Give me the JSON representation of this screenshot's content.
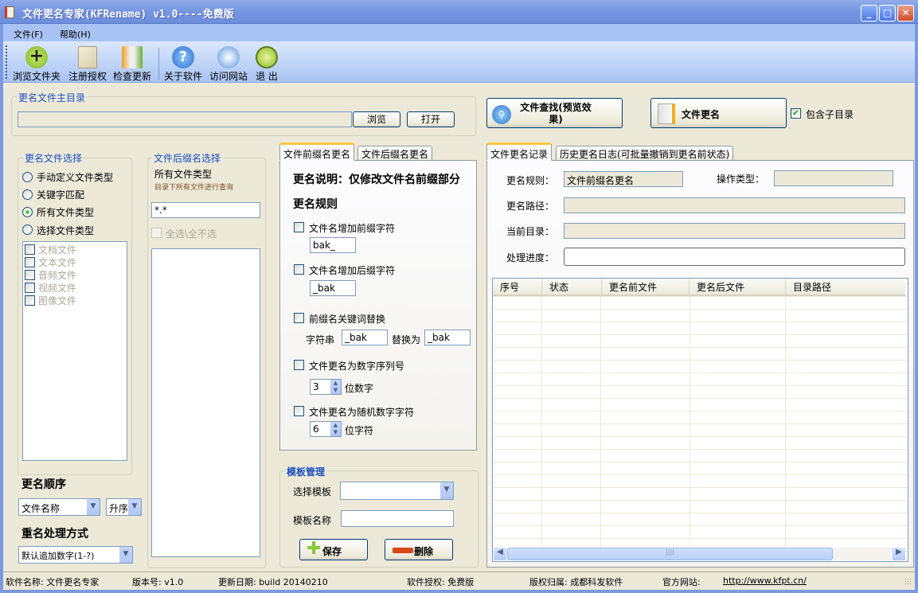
{
  "window": {
    "title": "文件更名专家(KFRename) v1.0----免费版",
    "minimize": "_",
    "maximize": "□",
    "close": "✕"
  },
  "menu": [
    "文件(F)",
    "帮助(H)"
  ],
  "toolbar": [
    {
      "label": "浏览文件夹",
      "icon": "add-folder-icon"
    },
    {
      "label": "注册授权",
      "icon": "key-document-icon"
    },
    {
      "label": "检查更新",
      "icon": "update-icon"
    },
    {
      "label": "关于软件",
      "icon": "help-icon"
    },
    {
      "label": "访问网站",
      "icon": "globe-icon"
    },
    {
      "label": "退 出",
      "icon": "exit-clock-icon"
    }
  ],
  "main_dir": {
    "legend": "更名文件主目录",
    "value": "",
    "browse": "浏览",
    "open": "打开"
  },
  "actions": {
    "search": "文件查找(预览效果)",
    "rename": "文件更名",
    "include_subdirs": "包含子目录",
    "include_subdirs_checked": true
  },
  "file_select": {
    "legend": "更名文件选择",
    "options": [
      "手动定义文件类型",
      "关键字匹配",
      "所有文件类型",
      "选择文件类型"
    ],
    "selected": 2,
    "types": [
      "文档文件",
      "文本文件",
      "音频文件",
      "视频文件",
      "图像文件"
    ]
  },
  "ext_select": {
    "legend": "文件后缀名选择",
    "title": "所有文件类型",
    "hint": "目录下所有文件进行查询",
    "pattern": "*.*",
    "select_all": "全选\\全不选"
  },
  "order": {
    "label": "更名顺序",
    "field": "文件名称",
    "direction": "升序"
  },
  "dup": {
    "label": "重名处理方式",
    "value": "默认追加数字(1-?)"
  },
  "mid_tabs": [
    "文件前缀名更名",
    "文件后缀名更名"
  ],
  "rules": {
    "desc": "更名说明：仅修改文件名前缀部分",
    "title": "更名规则",
    "add_prefix": "文件名增加前缀字符",
    "prefix_val": "bak_",
    "add_suffix": "文件名增加后缀字符",
    "suffix_val": "_bak",
    "replace": "前缀名关键词替换",
    "str_label": "字符串",
    "str_val": "_bak",
    "replace_label": "替换为",
    "replace_val": "_bak",
    "seq": "文件更名为数字序列号",
    "seq_val": "3",
    "seq_unit": "位数字",
    "rand": "文件更名为随机数字字符",
    "rand_val": "6",
    "rand_unit": "位字符"
  },
  "template": {
    "legend": "模板管理",
    "select_label": "选择模板",
    "select_val": "",
    "name_label": "模板名称",
    "name_val": "",
    "save": "保存",
    "delete": "删除"
  },
  "right_tabs": [
    "文件更名记录",
    "历史更名日志(可批量撤销到更名前状态)"
  ],
  "record": {
    "rule_label": "更名规则：",
    "rule_val": "文件前缀名更名",
    "op_label": "操作类型：",
    "op_val": "",
    "path_label": "更名路径：",
    "path_val": "",
    "cur_label": "当前目录：",
    "cur_val": "",
    "prog_label": "处理进度：",
    "progress": 0
  },
  "grid": {
    "columns": [
      "序号",
      "状态",
      "更名前文件",
      "更名后文件",
      "目录路径"
    ],
    "rows": []
  },
  "status": {
    "name": "软件名称: 文件更名专家",
    "version": "版本号: v1.0",
    "date": "更新日期: build 20140210",
    "license": "软件授权: 免费版",
    "owner": "版权归属: 成都科发软件",
    "site_label": "官方网站:",
    "site_url": "http://www.kfpt.cn/"
  }
}
